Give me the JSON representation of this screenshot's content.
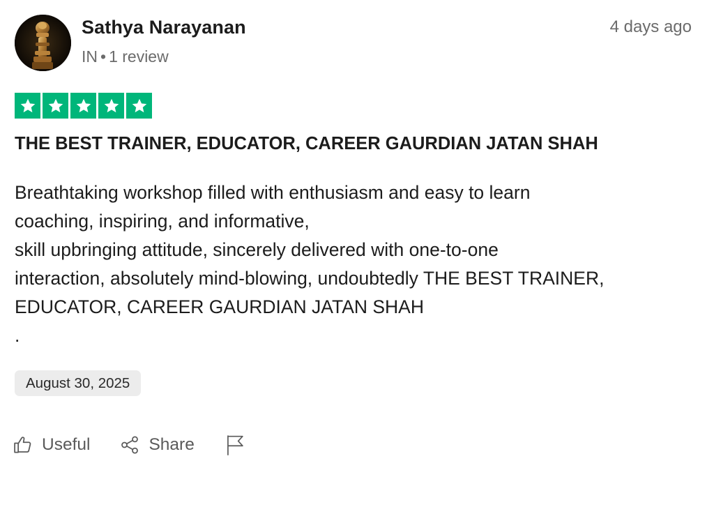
{
  "reviewer": {
    "name": "Sathya Narayanan",
    "country": "IN",
    "separator": "•",
    "review_count": "1 review"
  },
  "time_ago": "4 days ago",
  "rating": {
    "stars": 5,
    "out_of": 5,
    "color": "#00b67a"
  },
  "review": {
    "title": "THE BEST TRAINER, EDUCATOR, CAREER GAURDIAN JATAN SHAH",
    "body_lines": [
      "Breathtaking workshop filled with enthusiasm and easy to learn",
      "coaching, inspiring, and informative,",
      "skill upbringing attitude, sincerely delivered with one-to-one",
      "interaction, absolutely mind-blowing, undoubtedly THE BEST TRAINER,",
      "EDUCATOR, CAREER GAURDIAN JATAN SHAH",
      "."
    ],
    "date": "August 30, 2025"
  },
  "actions": {
    "useful_label": "Useful",
    "share_label": "Share",
    "useful_icon": "thumbs-up-icon",
    "share_icon": "share-icon",
    "report_icon": "flag-icon"
  }
}
